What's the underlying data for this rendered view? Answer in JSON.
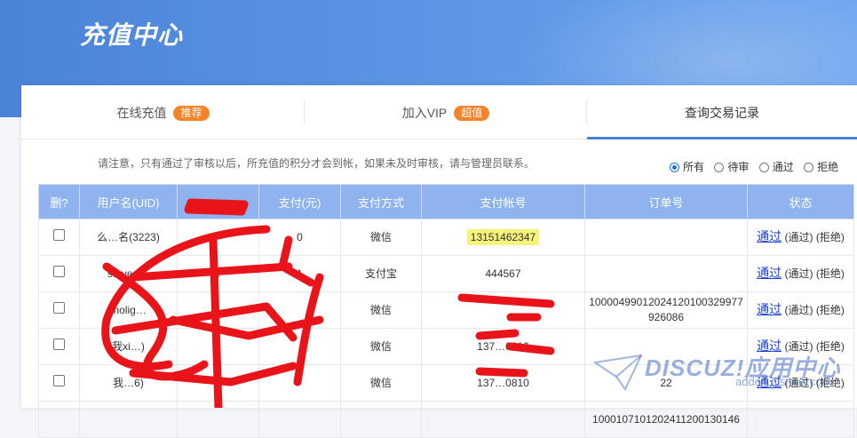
{
  "page": {
    "title": "充值中心"
  },
  "tabs": [
    {
      "label": "在线充值",
      "badge": "推荐"
    },
    {
      "label": "加入VIP",
      "badge": "超值"
    },
    {
      "label": "查询交易记录",
      "badge": ""
    }
  ],
  "notice": "请注意，只有通过了审核以后，所充值的积分才会到帐，如果未及时审核，请与管理员联系。",
  "filters": [
    {
      "label": "所有",
      "checked": true
    },
    {
      "label": "待审",
      "checked": false
    },
    {
      "label": "通过",
      "checked": false
    },
    {
      "label": "拒绝",
      "checked": false
    }
  ],
  "table": {
    "headers": [
      "删?",
      "用户名(UID)",
      "",
      "支付(元)",
      "支付方式",
      "支付帐号",
      "订单号",
      "状态"
    ],
    "rows": [
      {
        "user": "么…名(3223)",
        "amount": "",
        "paid": "0",
        "method": "微信",
        "account": "13151462347",
        "order": "",
        "status": "通过",
        "a1": "(通过)",
        "a2": "(拒绝)"
      },
      {
        "user": "steven…",
        "amount": ")",
        "paid": "1",
        "method": "支付宝",
        "account": "444567",
        "order": "",
        "status": "通过",
        "a1": "(通过)",
        "a2": "(拒绝)"
      },
      {
        "user": "molig…",
        "amount": "",
        "paid": "",
        "method": "微信",
        "account": "",
        "order": "100004990120241201003299​77926086",
        "status": "通过",
        "a1": "(通过)",
        "a2": "(拒绝)"
      },
      {
        "user": "我xi…)",
        "amount": "",
        "paid": "",
        "method": "微信",
        "account": "137…0810",
        "order": "",
        "status": "通过",
        "a1": "(通过)",
        "a2": "(拒绝)"
      },
      {
        "user": "我…6)",
        "amount": "0",
        "paid": "",
        "method": "微信",
        "account": "137…0810",
        "order": "22",
        "status": "通过",
        "a1": "(通过)",
        "a2": "(拒绝)"
      },
      {
        "user": "",
        "amount": "",
        "paid": "",
        "method": "",
        "account": "",
        "order": "100010710120241120013014​6",
        "status": "",
        "a1": "",
        "a2": ""
      }
    ]
  },
  "watermark": {
    "brand": "DISCUZ!应用中心",
    "url": "addon.dismall.com"
  },
  "colors": {
    "header_bg": "#4a84d8",
    "table_header": "#8fb3ee",
    "badge": "#f5832a",
    "link": "#1a3fcc"
  }
}
